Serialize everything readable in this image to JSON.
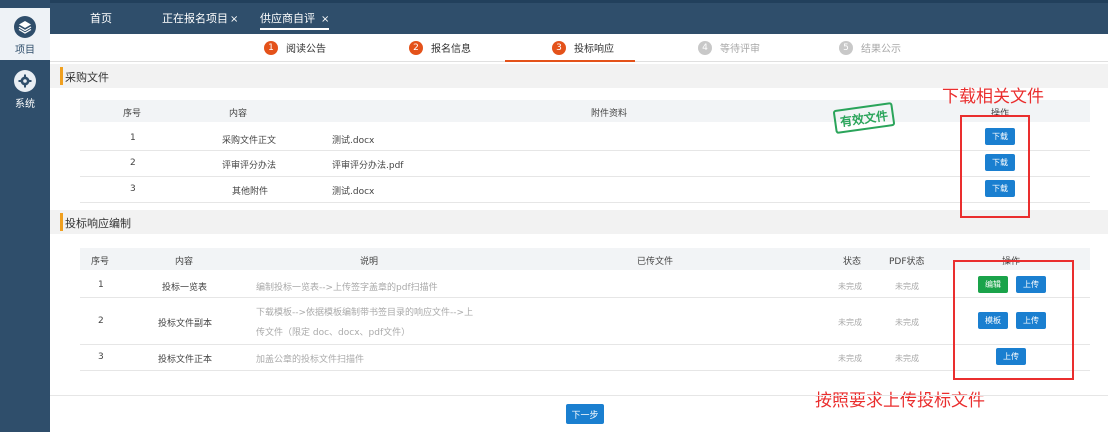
{
  "sidebar": {
    "items": [
      {
        "label": "项目",
        "icon": "layers-icon"
      },
      {
        "label": "系统",
        "icon": "gear-icon"
      }
    ]
  },
  "top_tabs": [
    {
      "label": "首页",
      "closable": false
    },
    {
      "label": "正在报名项目",
      "closable": true
    },
    {
      "label": "供应商自评",
      "closable": true
    }
  ],
  "steps": [
    {
      "num": "1",
      "label": "阅读公告",
      "state": "done"
    },
    {
      "num": "2",
      "label": "报名信息",
      "state": "done"
    },
    {
      "num": "3",
      "label": "投标响应",
      "state": "done"
    },
    {
      "num": "4",
      "label": "等待评审",
      "state": "pending"
    },
    {
      "num": "5",
      "label": "结果公示",
      "state": "pending"
    }
  ],
  "procurement": {
    "title": "采购文件",
    "headers": {
      "no": "序号",
      "content": "内容",
      "attachment": "附件资料",
      "action": "操作"
    },
    "rows": [
      {
        "no": "1",
        "content": "采购文件正文",
        "file": "测试.docx",
        "button": "下载"
      },
      {
        "no": "2",
        "content": "评审评分办法",
        "file": "评审评分办法.pdf",
        "button": "下载"
      },
      {
        "no": "3",
        "content": "其他附件",
        "file": "测试.docx",
        "button": "下载"
      }
    ],
    "stamp": "有效文件"
  },
  "response": {
    "title": "投标响应编制",
    "headers": {
      "no": "序号",
      "content": "内容",
      "desc": "说明",
      "uploaded": "已传文件",
      "status": "状态",
      "pdf_status": "PDF状态",
      "action": "操作"
    },
    "rows": [
      {
        "no": "1",
        "content": "投标一览表",
        "desc_line1": "编制投标一览表-->上传签字盖章的pdf扫描件",
        "desc_line2": "",
        "status": "未完成",
        "pdf_status": "未完成",
        "buttons": [
          "编辑",
          "上传"
        ]
      },
      {
        "no": "2",
        "content": "投标文件副本",
        "desc_line1": "下载模板-->依据模板编制带书签目录的响应文件-->上",
        "desc_line2": "传文件（限定 doc、docx、pdf文件）",
        "status": "未完成",
        "pdf_status": "未完成",
        "buttons": [
          "模板",
          "上传"
        ]
      },
      {
        "no": "3",
        "content": "投标文件正本",
        "desc_line1": "加盖公章的投标文件扫描件",
        "desc_line2": "",
        "status": "未完成",
        "pdf_status": "未完成",
        "buttons": [
          "上传"
        ]
      }
    ]
  },
  "annotations": {
    "download": "下载相关文件",
    "upload": "按照要求上传投标文件"
  },
  "footer": {
    "next": "下一步"
  },
  "colors": {
    "sidebar": "#2f4e6b",
    "accent": "#e4521a",
    "primary_button": "#1a7fd0",
    "edit_button": "#1aa34a",
    "annotation": "#ea2e2e",
    "section_bar": "#f0a020"
  }
}
